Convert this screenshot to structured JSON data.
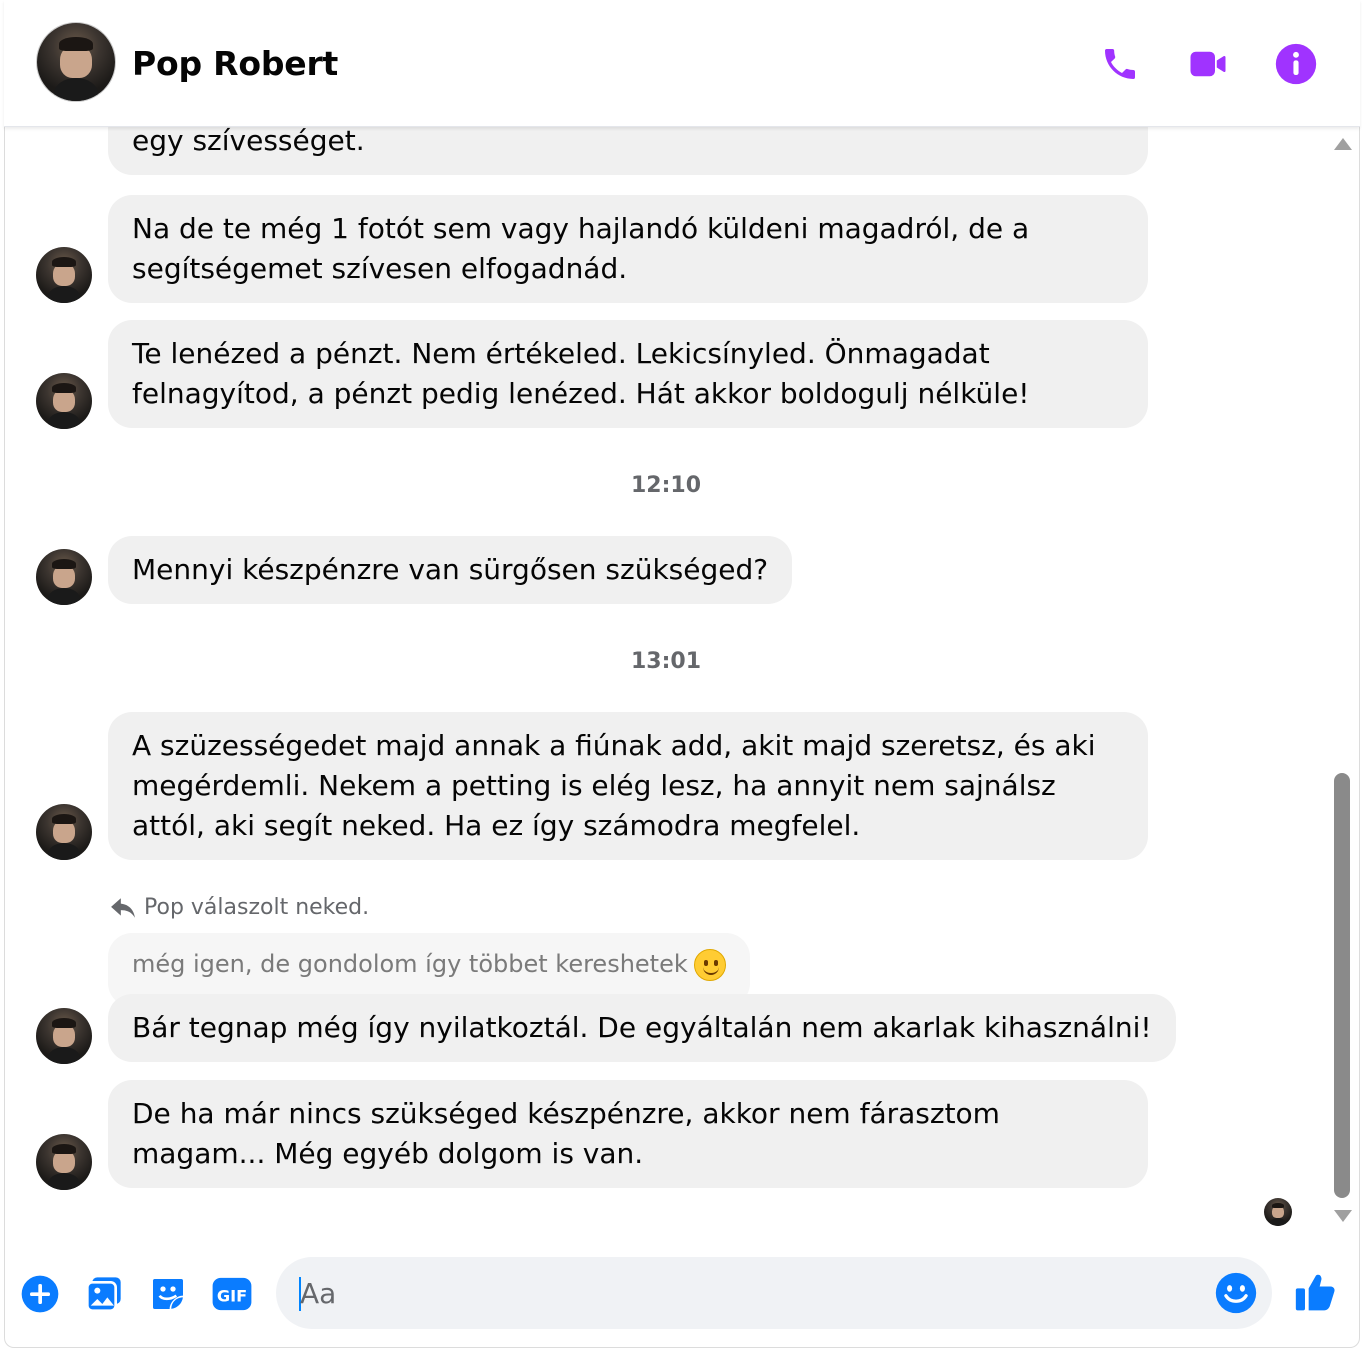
{
  "header": {
    "contact_name": "Pop Robert",
    "accent_color": "#a033ff",
    "buttons": [
      "phone-icon",
      "video-icon",
      "info-icon"
    ]
  },
  "messages": [
    {
      "id": "m0",
      "text": "egy szívességet."
    },
    {
      "id": "m1",
      "text": "Na de te még 1 fotót sem vagy hajlandó küldeni magadról, de a segítségemet szívesen elfogadnád."
    },
    {
      "id": "m2",
      "text": "Te lenézed a pénzt. Nem értékeled. Lekicsínyled. Önmagadat felnagyítod, a pénzt pedig lenézed. Hát akkor boldogulj nélküle!"
    },
    {
      "id": "t1",
      "timestamp": "12:10"
    },
    {
      "id": "m3",
      "text": "Mennyi készpénzre van sürgősen szükséged?"
    },
    {
      "id": "t2",
      "timestamp": "13:01"
    },
    {
      "id": "m4",
      "text": "A szüzességedet majd annak a fiúnak add, akit majd szeretsz, és aki megérdemli. Nekem a petting is elég lesz, ha annyit nem sajnálsz attól, aki segít neked. Ha ez így számodra megfelel."
    },
    {
      "id": "m5",
      "reply_note": "Pop válaszolt neked.",
      "quoted": "még igen, de gondolom így többet kereshetek",
      "text": "Bár tegnap még így nyilatkoztál. De egyáltalán nem akarlak kihasználni!"
    },
    {
      "id": "m6",
      "text": "De ha már nincs szükséged készpénzre,  akkor nem fárasztom magam... Még egyéb dolgom is van."
    }
  ],
  "composer": {
    "placeholder": "Aa",
    "icons": [
      "plus-icon",
      "image-icon",
      "sticker-icon",
      "gif-icon",
      "emoji-icon",
      "like-icon"
    ],
    "gif_label": "GIF",
    "icon_color": "#0a7cff"
  }
}
